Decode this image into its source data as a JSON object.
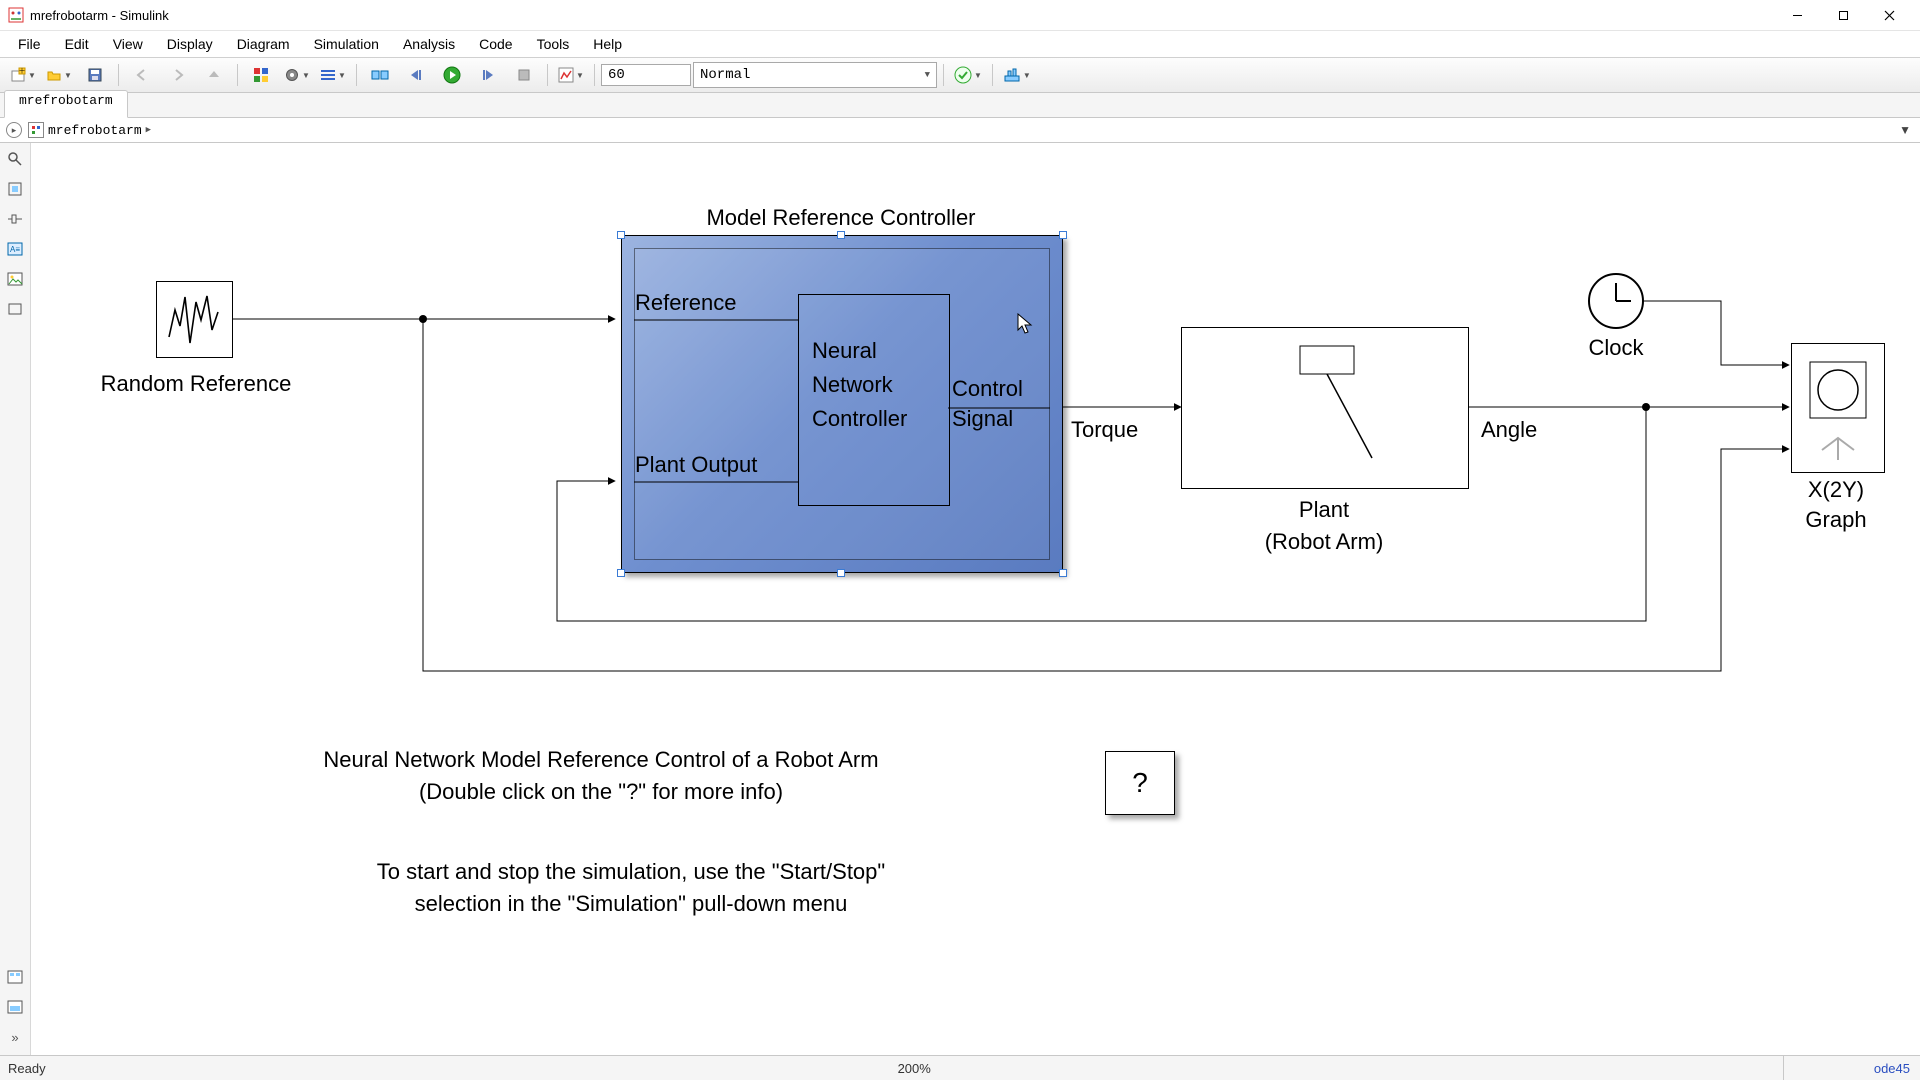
{
  "window": {
    "title": "mrefrobotarm - Simulink"
  },
  "menu": {
    "items": [
      "File",
      "Edit",
      "View",
      "Display",
      "Diagram",
      "Simulation",
      "Analysis",
      "Code",
      "Tools",
      "Help"
    ]
  },
  "toolbar": {
    "stoptime": "60",
    "sim_mode": "Normal"
  },
  "tabs": {
    "0": "mrefrobotarm"
  },
  "breadcrumb": {
    "model": "mrefrobotarm"
  },
  "status": {
    "ready": "Ready",
    "zoom": "200%",
    "solver": "ode45"
  },
  "diagram": {
    "controller_title": "Model Reference Controller",
    "random_ref": "Random Reference",
    "reference": "Reference",
    "plant_output": "Plant Output",
    "nn1": "Neural",
    "nn2": "Network",
    "nn3": "Controller",
    "ctrl1": "Control",
    "ctrl2": "Signal",
    "torque": "Torque",
    "angle": "Angle",
    "plant1": "Plant",
    "plant2": "(Robot Arm)",
    "clock": "Clock",
    "graph1": "X(2Y)",
    "graph2": "Graph",
    "help": "?",
    "info1": "Neural Network Model Reference Control of a Robot Arm",
    "info2": "(Double click on the \"?\" for more info)",
    "info3": "To start and stop the simulation, use the \"Start/Stop\"",
    "info4": "selection in the \"Simulation\" pull-down menu"
  }
}
